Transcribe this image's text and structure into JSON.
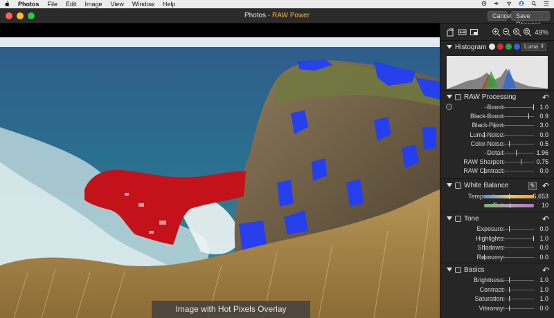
{
  "menubar": {
    "app_name": "Photos",
    "items": [
      "File",
      "Edit",
      "Image",
      "View",
      "Window",
      "Help"
    ]
  },
  "window": {
    "title_app": "Photos",
    "title_sep": " - ",
    "title_mode": "RAW Power",
    "cancel_label": "Cancel",
    "save_label": "Save Changes"
  },
  "image": {
    "caption": "Image with Hot Pixels Overlay"
  },
  "toolbar": {
    "zoom_percent": "49%"
  },
  "histogram": {
    "title": "Histogram",
    "channel": "Luma",
    "colors": {
      "luma": "#e6e6e6",
      "red": "#d83030",
      "green": "#2fa33a",
      "blue": "#2f66d8"
    }
  },
  "raw_processing": {
    "title": "RAW Processing",
    "rows": [
      {
        "label": "Boost:",
        "value": "1.0",
        "pos": 1.0
      },
      {
        "label": "Black Boost:",
        "value": "0.9",
        "pos": 0.9
      },
      {
        "label": "Black Point:",
        "value": "3.0",
        "pos": 0.2
      },
      {
        "label": "Luma Noise:",
        "value": "0.0",
        "pos": 0.0
      },
      {
        "label": "Color Noise:",
        "value": "0.5",
        "pos": 0.5
      },
      {
        "label": "Detail:",
        "value": "1.96",
        "pos": 0.65
      },
      {
        "label": "RAW Sharpen:",
        "value": "0.75",
        "pos": 0.75
      },
      {
        "label": "RAW Contrast:",
        "value": "0.0",
        "pos": 0.0
      }
    ]
  },
  "white_balance": {
    "title": "White Balance",
    "temperature_label": "Temperature:",
    "temperature_value": "5,653",
    "temperature_pos": 0.5,
    "tint_label": "Tint:",
    "tint_value": "10",
    "tint_pos": 0.52
  },
  "tone": {
    "title": "Tone",
    "rows": [
      {
        "label": "Exposure:",
        "value": "0.0",
        "pos": 0.5
      },
      {
        "label": "Highlights:",
        "value": "1.0",
        "pos": 1.0
      },
      {
        "label": "Shadows:",
        "value": "0.0",
        "pos": 0.0
      },
      {
        "label": "Recovery:",
        "value": "0.0",
        "pos": 0.0
      }
    ]
  },
  "basics": {
    "title": "Basics",
    "rows": [
      {
        "label": "Brightness:",
        "value": "1.0",
        "pos": 0.5
      },
      {
        "label": "Contrast:",
        "value": "1.0",
        "pos": 0.5
      },
      {
        "label": "Saturation:",
        "value": "1.0",
        "pos": 0.5
      },
      {
        "label": "Vibrancy:",
        "value": "0.0",
        "pos": 0.5
      }
    ]
  }
}
